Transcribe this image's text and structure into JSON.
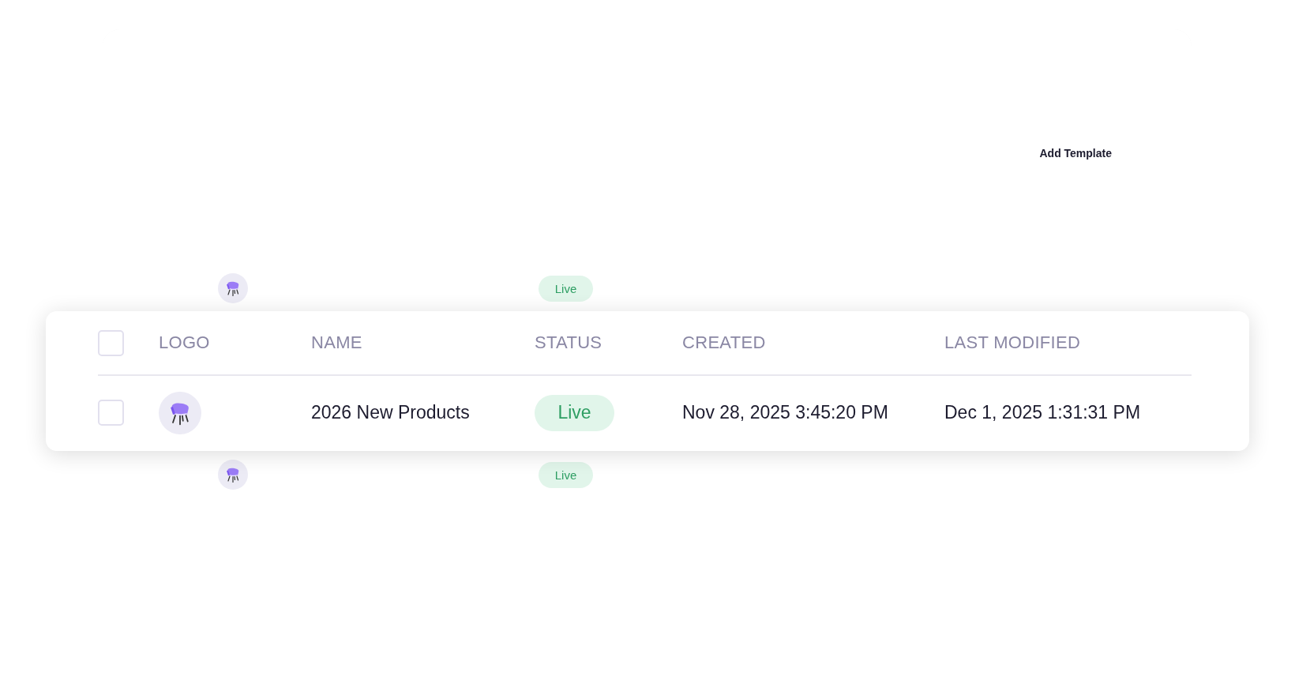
{
  "toolbar": {
    "add_button": "Add Template"
  },
  "background_rows": [
    {
      "status": "Live"
    },
    {
      "status": "Live"
    }
  ],
  "table": {
    "select_all": {
      "checked": false
    },
    "columns": [
      "LOGO",
      "NAME",
      "STATUS",
      "CREATED",
      "LAST MODIFIED"
    ],
    "rows": [
      {
        "checked": false,
        "name": "2026 New Products",
        "status": "Live",
        "created": "Nov 28, 2025 3:45:20 PM",
        "last_modified": "Dec 1, 2025 1:31:31 PM"
      }
    ]
  }
}
